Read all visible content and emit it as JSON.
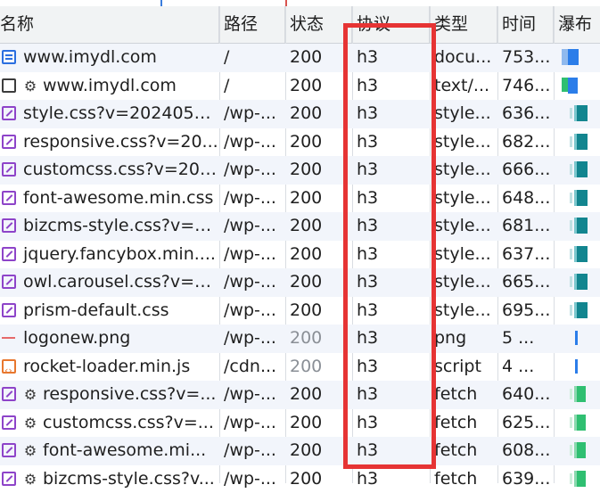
{
  "header": {
    "name": "名称",
    "path": "路径",
    "status": "状态",
    "protocol": "协议",
    "type": "类型",
    "time": "时间",
    "waterfall": "瀑布"
  },
  "rows": [
    {
      "icon": "document-icon",
      "gear": "",
      "name": "www.imydl.com",
      "path": "/",
      "status": "200",
      "status_muted": false,
      "protocol": "h3",
      "type": "docu...",
      "time": "753...",
      "wf": "blue"
    },
    {
      "icon": "blank-doc-icon",
      "gear": "⚙",
      "name": "www.imydl.com",
      "path": "/",
      "status": "200",
      "status_muted": false,
      "protocol": "h3",
      "type": "text/...",
      "time": "746...",
      "wf": "green-blue"
    },
    {
      "icon": "stylesheet-icon",
      "gear": "",
      "name": "style.css?v=2024050...",
      "path": "/wp-...",
      "status": "200",
      "status_muted": false,
      "protocol": "h3",
      "type": "style...",
      "time": "636...",
      "wf": "teal"
    },
    {
      "icon": "stylesheet-icon",
      "gear": "",
      "name": "responsive.css?v=20...",
      "path": "/wp-...",
      "status": "200",
      "status_muted": false,
      "protocol": "h3",
      "type": "style...",
      "time": "682...",
      "wf": "teal"
    },
    {
      "icon": "stylesheet-icon",
      "gear": "",
      "name": "customcss.css?v=202...",
      "path": "/wp-...",
      "status": "200",
      "status_muted": false,
      "protocol": "h3",
      "type": "style...",
      "time": "666...",
      "wf": "teal"
    },
    {
      "icon": "stylesheet-icon",
      "gear": "",
      "name": "font-awesome.min.css",
      "path": "/wp-...",
      "status": "200",
      "status_muted": false,
      "protocol": "h3",
      "type": "style...",
      "time": "648...",
      "wf": "teal"
    },
    {
      "icon": "stylesheet-icon",
      "gear": "",
      "name": "bizcms-style.css?v=2...",
      "path": "/wp-...",
      "status": "200",
      "status_muted": false,
      "protocol": "h3",
      "type": "style...",
      "time": "681...",
      "wf": "teal"
    },
    {
      "icon": "stylesheet-icon",
      "gear": "",
      "name": "jquery.fancybox.min....",
      "path": "/wp-...",
      "status": "200",
      "status_muted": false,
      "protocol": "h3",
      "type": "style...",
      "time": "637...",
      "wf": "teal"
    },
    {
      "icon": "stylesheet-icon",
      "gear": "",
      "name": "owl.carousel.css?v=2...",
      "path": "/wp-...",
      "status": "200",
      "status_muted": false,
      "protocol": "h3",
      "type": "style...",
      "time": "665...",
      "wf": "teal"
    },
    {
      "icon": "stylesheet-icon",
      "gear": "",
      "name": "prism-default.css",
      "path": "/wp-...",
      "status": "200",
      "status_muted": false,
      "protocol": "h3",
      "type": "style...",
      "time": "695...",
      "wf": "teal"
    },
    {
      "icon": "image-icon",
      "gear": "",
      "name": "logonew.png",
      "path": "/wp-...",
      "status": "200",
      "status_muted": true,
      "protocol": "h3",
      "type": "png",
      "time": "5 ...",
      "wf": "thin"
    },
    {
      "icon": "script-icon",
      "gear": "",
      "name": "rocket-loader.min.js",
      "path": "/cdn...",
      "status": "200",
      "status_muted": true,
      "protocol": "h3",
      "type": "script",
      "time": "4 ...",
      "wf": "thin"
    },
    {
      "icon": "stylesheet-icon",
      "gear": "⚙",
      "name": "responsive.css?v=...",
      "path": "/wp-...",
      "status": "200",
      "status_muted": false,
      "protocol": "h3",
      "type": "fetch",
      "time": "640...",
      "wf": "green"
    },
    {
      "icon": "stylesheet-icon",
      "gear": "⚙",
      "name": "customcss.css?v=...",
      "path": "/wp-...",
      "status": "200",
      "status_muted": false,
      "protocol": "h3",
      "type": "fetch",
      "time": "625...",
      "wf": "green"
    },
    {
      "icon": "stylesheet-icon",
      "gear": "⚙",
      "name": "font-awesome.mi...",
      "path": "/wp-...",
      "status": "200",
      "status_muted": false,
      "protocol": "h3",
      "type": "fetch",
      "time": "608...",
      "wf": "green"
    },
    {
      "icon": "stylesheet-icon",
      "gear": "⚙",
      "name": "bizcms-style.css?v...",
      "path": "/wp-...",
      "status": "200",
      "status_muted": false,
      "protocol": "h3",
      "type": "fetch",
      "time": "639...",
      "wf": "green"
    }
  ],
  "colors": {
    "blue": "#2b7de9",
    "teal": "#12858f",
    "green": "#2fbf71",
    "highlight": "#e63434"
  }
}
